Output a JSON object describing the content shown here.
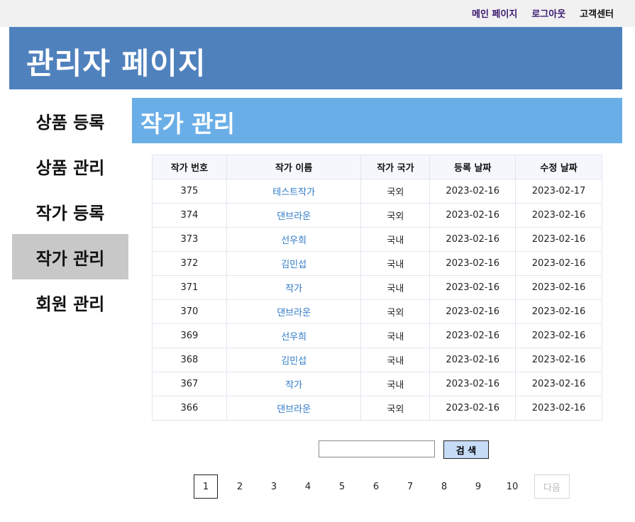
{
  "topnav": {
    "main_page": "메인 페이지",
    "logout": "로그아웃",
    "support": "고객센터"
  },
  "header": {
    "title": "관리자 페이지"
  },
  "sidebar": {
    "items": [
      {
        "label": "상품 등록"
      },
      {
        "label": "상품 관리"
      },
      {
        "label": "작가 등록"
      },
      {
        "label": "작가 관리",
        "active": true
      },
      {
        "label": "회원 관리"
      }
    ]
  },
  "section": {
    "title": "작가 관리"
  },
  "table": {
    "headers": [
      "작가 번호",
      "작가 이름",
      "작가 국가",
      "등록 날짜",
      "수정 날짜"
    ],
    "rows": [
      [
        "375",
        "테스트작가",
        "국외",
        "2023-02-16",
        "2023-02-17"
      ],
      [
        "374",
        "댄브라운",
        "국외",
        "2023-02-16",
        "2023-02-16"
      ],
      [
        "373",
        "선우희",
        "국내",
        "2023-02-16",
        "2023-02-16"
      ],
      [
        "372",
        "김민섭",
        "국내",
        "2023-02-16",
        "2023-02-16"
      ],
      [
        "371",
        "작가",
        "국내",
        "2023-02-16",
        "2023-02-16"
      ],
      [
        "370",
        "댄브라운",
        "국외",
        "2023-02-16",
        "2023-02-16"
      ],
      [
        "369",
        "선우희",
        "국내",
        "2023-02-16",
        "2023-02-16"
      ],
      [
        "368",
        "김민섭",
        "국내",
        "2023-02-16",
        "2023-02-16"
      ],
      [
        "367",
        "작가",
        "국내",
        "2023-02-16",
        "2023-02-16"
      ],
      [
        "366",
        "댄브라운",
        "국외",
        "2023-02-16",
        "2023-02-16"
      ]
    ]
  },
  "search": {
    "value": "",
    "button_label": "검 색"
  },
  "pagination": {
    "pages": [
      "1",
      "2",
      "3",
      "4",
      "5",
      "6",
      "7",
      "8",
      "9",
      "10"
    ],
    "current": "1",
    "next_label": "다음"
  },
  "colors": {
    "header_bg": "#4f81bd",
    "section_bg": "#6aaee8",
    "active_sidebar_bg": "#c8c8c8",
    "link": "#2e7ac7",
    "search_button_bg": "#c6dcf6"
  }
}
